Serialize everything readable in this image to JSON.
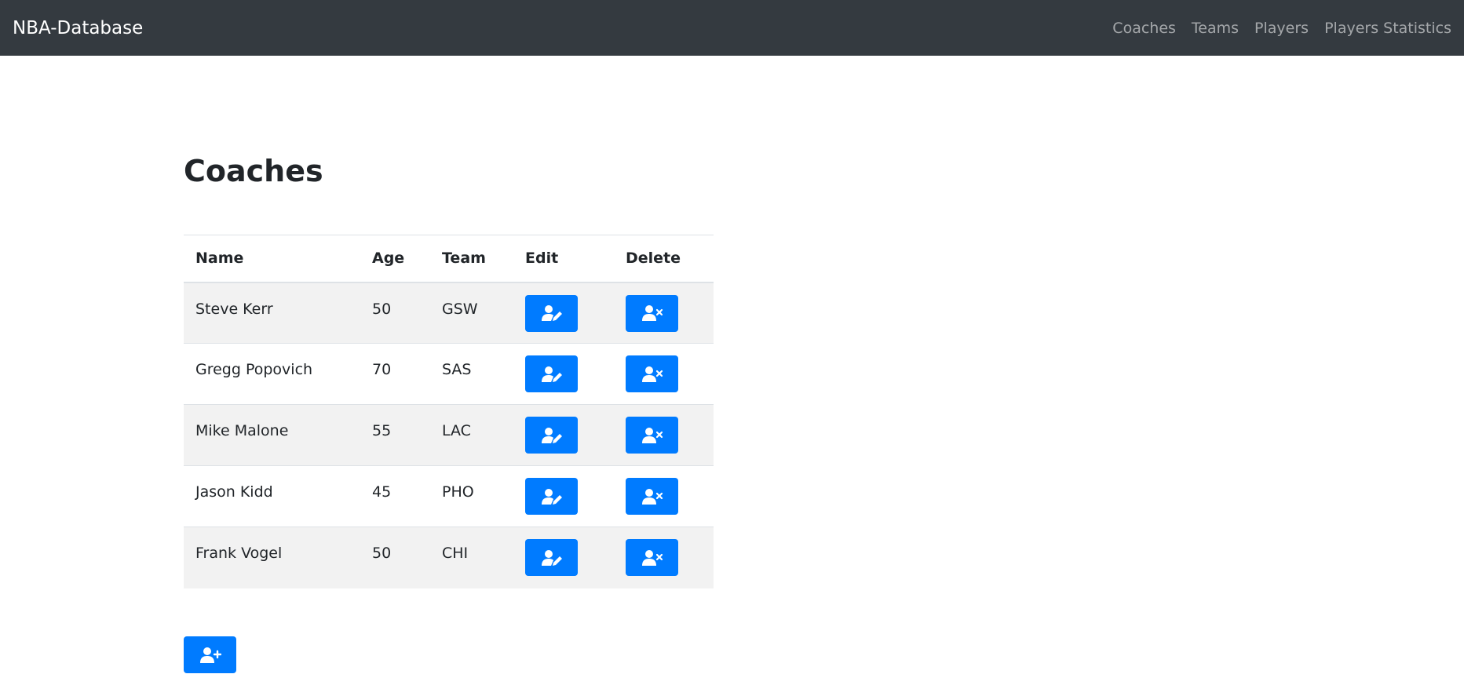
{
  "navbar": {
    "brand": "NBA-Database",
    "links": [
      "Coaches",
      "Teams",
      "Players",
      "Players Statistics"
    ]
  },
  "page": {
    "title": "Coaches"
  },
  "table": {
    "headers": [
      "Name",
      "Age",
      "Team",
      "Edit",
      "Delete"
    ],
    "rows": [
      {
        "name": "Steve Kerr",
        "age": "50",
        "team": "GSW"
      },
      {
        "name": "Gregg Popovich",
        "age": "70",
        "team": "SAS"
      },
      {
        "name": "Mike Malone",
        "age": "55",
        "team": "LAC"
      },
      {
        "name": "Jason Kidd",
        "age": "45",
        "team": "PHO"
      },
      {
        "name": "Frank Vogel",
        "age": "50",
        "team": "CHI"
      }
    ]
  },
  "icons": {
    "edit": "user-edit-icon",
    "delete": "user-times-icon",
    "add": "user-plus-icon"
  },
  "colors": {
    "navbar_bg": "#343a40",
    "primary": "#007bff",
    "striped_row": "#f2f2f2"
  }
}
